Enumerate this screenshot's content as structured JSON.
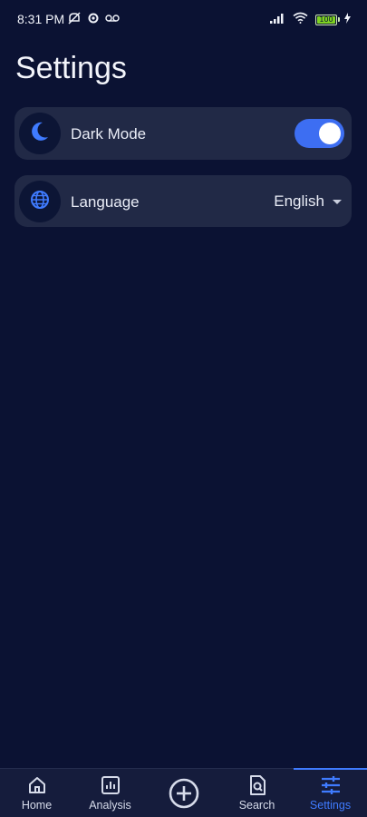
{
  "status_bar": {
    "time": "8:31 PM",
    "battery": "100"
  },
  "page": {
    "title": "Settings"
  },
  "settings": {
    "dark_mode": {
      "label": "Dark Mode",
      "enabled": true,
      "icon": "moon-icon"
    },
    "language": {
      "label": "Language",
      "value": "English",
      "icon": "globe-icon"
    }
  },
  "bottom_nav": {
    "items": [
      {
        "label": "Home",
        "icon": "home-icon"
      },
      {
        "label": "Analysis",
        "icon": "bar-chart-icon"
      },
      {
        "label": "",
        "icon": "add-circle-icon"
      },
      {
        "label": "Search",
        "icon": "search-document-icon"
      },
      {
        "label": "Settings",
        "icon": "sliders-icon"
      }
    ],
    "active": "Settings"
  },
  "colors": {
    "background": "#0b1233",
    "card": "#212946",
    "accent": "#3f7bff",
    "toggle_on": "#3d6ef2"
  }
}
